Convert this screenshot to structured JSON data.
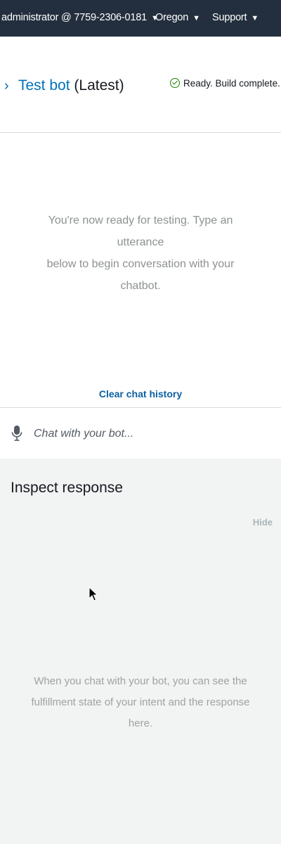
{
  "topbar": {
    "account": "administrator @ 7759-2306-0181",
    "region": "Oregon",
    "support": "Support",
    "caret": "▼"
  },
  "header": {
    "bot_name": "Test bot",
    "version": "(Latest)",
    "status": "Ready. Build complete."
  },
  "chat": {
    "empty_line1": "You're now ready for testing. Type an utterance",
    "empty_line2": "below to begin conversation with your chatbot.",
    "clear_history": "Clear chat history",
    "input_placeholder": "Chat with your bot..."
  },
  "inspect": {
    "title": "Inspect response",
    "hide": "Hide",
    "empty_line1": "When you chat with your bot, you can see the",
    "empty_line2": "fulfillment state of your intent and the response here."
  },
  "colors": {
    "topbar_bg": "#232f3e",
    "link_blue": "#0073bb",
    "success_green": "#1d8102",
    "panel_gray": "#f2f3f3"
  },
  "icons": {
    "expand": "chevron-right-icon",
    "status": "check-circle-icon",
    "mic": "microphone-icon",
    "cursor": "mouse-pointer-icon"
  }
}
